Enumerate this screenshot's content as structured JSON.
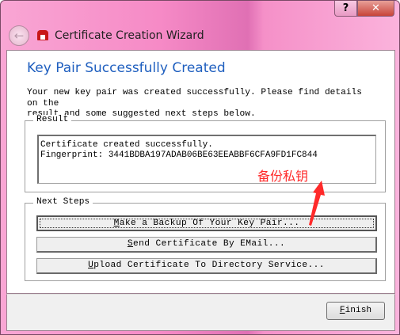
{
  "window": {
    "title": "Certificate Creation Wizard",
    "help_glyph": "?",
    "close_glyph": "✕",
    "back_glyph": "←"
  },
  "page": {
    "heading": "Key Pair Successfully Created",
    "description": "Your new key pair was created successfully. Please find details on the\nresult and some suggested next steps below."
  },
  "result": {
    "label": "Result",
    "line1": "Certificate created successfully.",
    "line2": "Fingerprint: 3441BDBA197ADAB06BE63EEABBF6CFA9FD1FC844"
  },
  "next_steps": {
    "label": "Next Steps",
    "buttons": [
      {
        "mnemonic": "M",
        "rest": "ake a Backup Of Your Key Pair..."
      },
      {
        "pre": "",
        "mnemonic": "S",
        "rest": "end Certificate By EMail..."
      },
      {
        "mnemonic": "U",
        "rest": "pload Certificate To Directory Service..."
      }
    ]
  },
  "footer": {
    "finish_mnemonic": "F",
    "finish_rest": "inish"
  },
  "annotation": {
    "text": "备份私钥",
    "color": "#ff2a2a"
  }
}
